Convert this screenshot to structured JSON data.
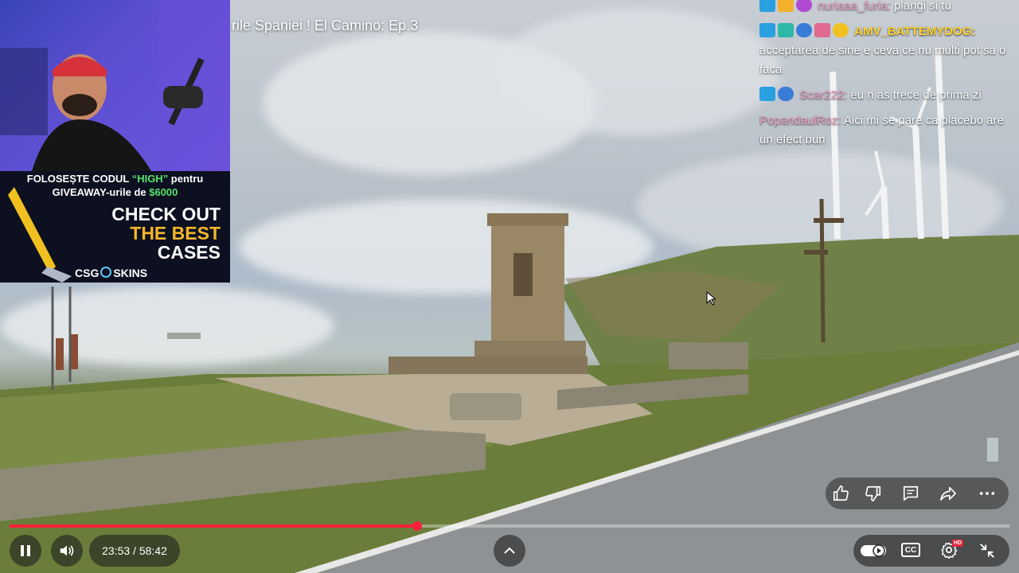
{
  "video": {
    "title": "rile Spaniei ! El Camino: Ep.3",
    "time_current": "23:53",
    "time_separator": " / ",
    "time_total": "58:42",
    "progress": 0.408,
    "accent_color": "#ff1f3c"
  },
  "sponsor": {
    "line1_prefix": "FOLOSEȘTE CODUL ",
    "line1_code": "“HIGH”",
    "line1_suffix": " pentru",
    "line2_prefix": "GIVEAWAY-urile de ",
    "line2_amount": "$6000",
    "cta_line1": "CHECK OUT",
    "cta_line2": "THE BEST",
    "cta_line3": "CASES",
    "brand": "CSG",
    "brand_suffix": "SKINS"
  },
  "chat": {
    "messages": [
      {
        "user": "nuriaaa_furia:",
        "text": " plangi si tu",
        "user_color": "#f0a0c8"
      },
      {
        "user": "AMV_BATTEMYDOG:",
        "text": " acceptarea de sine e ceva ce nu multi pot sa o faca",
        "user_color": "#ffd230"
      },
      {
        "user": "Scar222:",
        "text": " eu n as trece de prima zi",
        "user_color": "#f0a0c8"
      },
      {
        "user": "PopandaulRoz:",
        "text": " Aici mi se pare ca placebo are un efect bun",
        "user_color": "#f0a0c8"
      }
    ]
  },
  "icons": {
    "like": "like-icon",
    "dislike": "dislike-icon",
    "comment": "comment-icon",
    "share": "share-icon",
    "more": "more-icon",
    "pause": "pause-icon",
    "volume": "volume-icon",
    "chevron": "chevron-up-icon",
    "autoplay": "autoplay-toggle-icon",
    "captions": "captions-icon",
    "settings": "settings-icon",
    "exit_fullscreen": "exit-fullscreen-icon"
  },
  "controls": {
    "captions_label": "CC",
    "hd_badge": "HD"
  }
}
